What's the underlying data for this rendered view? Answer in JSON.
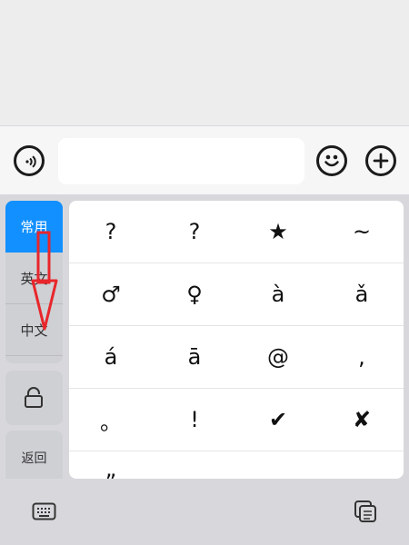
{
  "input_bar": {
    "voice_icon": "voice-waves-icon",
    "text_value": "",
    "emoji_icon": "smile-icon",
    "plus_icon": "plus-icon"
  },
  "sidebar": {
    "tabs": [
      {
        "label": "常用",
        "active": true
      },
      {
        "label": "英文",
        "active": false
      },
      {
        "label": "中文",
        "active": false
      }
    ],
    "lock_icon": "lock-icon",
    "back_label": "返回"
  },
  "symbols": [
    "?",
    "?",
    "★",
    "~",
    "♂",
    "♀",
    "à",
    "ǎ",
    "á",
    "ā",
    "@",
    ",",
    "。",
    "!",
    "✔",
    "✘",
    "”"
  ],
  "bottom_bar": {
    "keyboard_icon": "keyboard-icon",
    "copy_icon": "copy-icon"
  },
  "annotation": {
    "color": "#e8262b",
    "icon": "down-arrow-icon"
  }
}
